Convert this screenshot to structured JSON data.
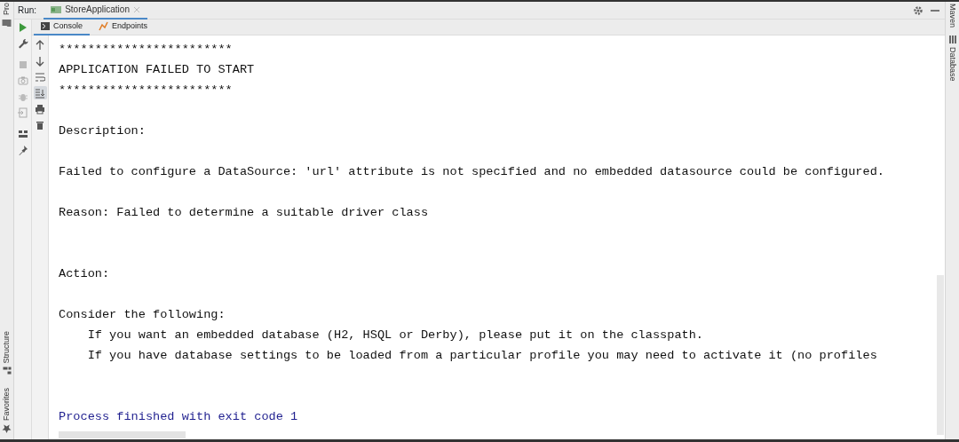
{
  "left_strip": {
    "items": [
      {
        "label": "Pro",
        "kind": "folder"
      },
      {
        "label": "Structure",
        "kind": "structure"
      },
      {
        "label": "Favorites",
        "kind": "star"
      }
    ]
  },
  "run_header": {
    "label": "Run:",
    "tabs": [
      {
        "label": "StoreApplication",
        "selected": true
      }
    ]
  },
  "sub_tabs": [
    {
      "label": "Console",
      "selected": true,
      "kind": "console"
    },
    {
      "label": "Endpoints",
      "selected": false,
      "kind": "endpoints"
    }
  ],
  "run_toolbar": [
    {
      "kind": "run",
      "disabled": false
    },
    {
      "kind": "wrench",
      "disabled": false
    },
    {
      "kind": "stop",
      "disabled": true
    },
    {
      "kind": "camera",
      "disabled": true
    },
    {
      "kind": "bug",
      "disabled": true
    },
    {
      "kind": "exit",
      "disabled": true
    },
    {
      "kind": "layout",
      "disabled": false
    },
    {
      "kind": "pin",
      "disabled": false
    }
  ],
  "console_toolbar": [
    {
      "kind": "up"
    },
    {
      "kind": "down"
    },
    {
      "kind": "wrap"
    },
    {
      "kind": "scroll-end",
      "selected": true
    },
    {
      "kind": "print"
    },
    {
      "kind": "trash"
    }
  ],
  "console": {
    "lines": [
      {
        "kind": "text",
        "text": "************************"
      },
      {
        "kind": "text",
        "text": "APPLICATION FAILED TO START"
      },
      {
        "kind": "text",
        "text": "************************"
      },
      {
        "kind": "blank"
      },
      {
        "kind": "text",
        "text": "Description:"
      },
      {
        "kind": "blank"
      },
      {
        "kind": "text",
        "text": "Failed to configure a DataSource: 'url' attribute is not specified and no embedded datasource could be configured."
      },
      {
        "kind": "blank"
      },
      {
        "kind": "text",
        "text": "Reason: Failed to determine a suitable driver class"
      },
      {
        "kind": "blank"
      },
      {
        "kind": "blank"
      },
      {
        "kind": "text",
        "text": "Action:"
      },
      {
        "kind": "blank"
      },
      {
        "kind": "text",
        "text": "Consider the following:"
      },
      {
        "kind": "text",
        "text": "    If you want an embedded database (H2, HSQL or Derby), please put it on the classpath."
      },
      {
        "kind": "text",
        "text": "    If you have database settings to be loaded from a particular profile you may need to activate it (no profiles"
      },
      {
        "kind": "blank"
      },
      {
        "kind": "blank"
      },
      {
        "kind": "exit",
        "text": "Process finished with exit code 1"
      }
    ]
  },
  "right_strip": {
    "items": [
      {
        "label": "Maven",
        "kind": "plain"
      },
      {
        "label": "Database",
        "kind": "database"
      }
    ]
  }
}
